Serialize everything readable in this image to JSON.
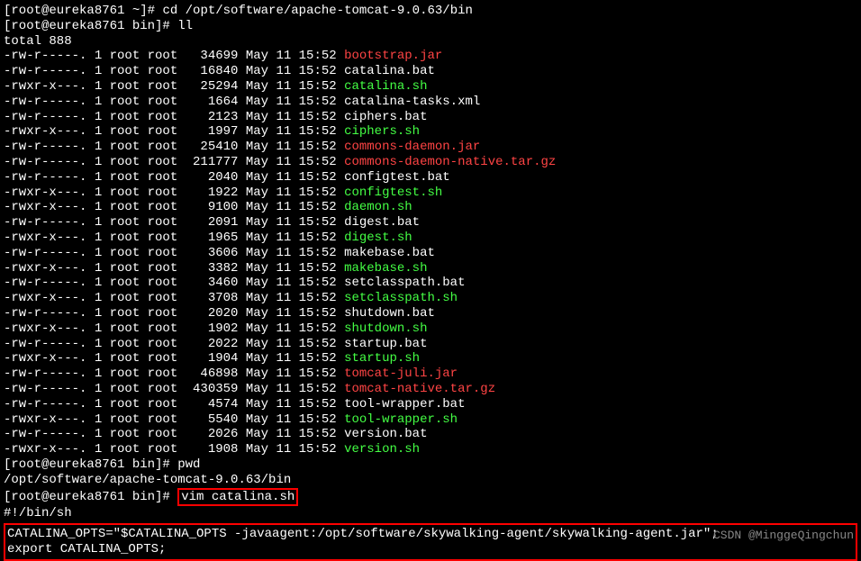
{
  "prompts": {
    "p1_host": "[root@eureka8761 ~]# ",
    "p1_cmd": "cd /opt/software/apache-tomcat-9.0.63/bin",
    "p2_host": "[root@eureka8761 bin]# ",
    "p2_cmd": "ll",
    "total": "total 888",
    "p3_host": "[root@eureka8761 bin]# ",
    "p3_cmd": "pwd",
    "pwd_output": "/opt/software/apache-tomcat-9.0.63/bin",
    "p4_host": "[root@eureka8761 bin]# ",
    "p4_cmd": "vim catalina.sh",
    "shebang": "#!/bin/sh",
    "empty": "",
    "catalina_opts": "CATALINA_OPTS=\"$CATALINA_OPTS -javaagent:/opt/software/skywalking-agent/skywalking-agent.jar\";",
    "export_line": "export CATALINA_OPTS;"
  },
  "files": [
    {
      "perms": "-rw-r-----. 1 root root   34699 May 11 15:52 ",
      "name": "bootstrap.jar",
      "color": "red"
    },
    {
      "perms": "-rw-r-----. 1 root root   16840 May 11 15:52 ",
      "name": "catalina.bat",
      "color": "white"
    },
    {
      "perms": "-rwxr-x---. 1 root root   25294 May 11 15:52 ",
      "name": "catalina.sh",
      "color": "green"
    },
    {
      "perms": "-rw-r-----. 1 root root    1664 May 11 15:52 ",
      "name": "catalina-tasks.xml",
      "color": "white"
    },
    {
      "perms": "-rw-r-----. 1 root root    2123 May 11 15:52 ",
      "name": "ciphers.bat",
      "color": "white"
    },
    {
      "perms": "-rwxr-x---. 1 root root    1997 May 11 15:52 ",
      "name": "ciphers.sh",
      "color": "green"
    },
    {
      "perms": "-rw-r-----. 1 root root   25410 May 11 15:52 ",
      "name": "commons-daemon.jar",
      "color": "red"
    },
    {
      "perms": "-rw-r-----. 1 root root  211777 May 11 15:52 ",
      "name": "commons-daemon-native.tar.gz",
      "color": "red"
    },
    {
      "perms": "-rw-r-----. 1 root root    2040 May 11 15:52 ",
      "name": "configtest.bat",
      "color": "white"
    },
    {
      "perms": "-rwxr-x---. 1 root root    1922 May 11 15:52 ",
      "name": "configtest.sh",
      "color": "green"
    },
    {
      "perms": "-rwxr-x---. 1 root root    9100 May 11 15:52 ",
      "name": "daemon.sh",
      "color": "green"
    },
    {
      "perms": "-rw-r-----. 1 root root    2091 May 11 15:52 ",
      "name": "digest.bat",
      "color": "white"
    },
    {
      "perms": "-rwxr-x---. 1 root root    1965 May 11 15:52 ",
      "name": "digest.sh",
      "color": "green"
    },
    {
      "perms": "-rw-r-----. 1 root root    3606 May 11 15:52 ",
      "name": "makebase.bat",
      "color": "white"
    },
    {
      "perms": "-rwxr-x---. 1 root root    3382 May 11 15:52 ",
      "name": "makebase.sh",
      "color": "green"
    },
    {
      "perms": "-rw-r-----. 1 root root    3460 May 11 15:52 ",
      "name": "setclasspath.bat",
      "color": "white"
    },
    {
      "perms": "-rwxr-x---. 1 root root    3708 May 11 15:52 ",
      "name": "setclasspath.sh",
      "color": "green"
    },
    {
      "perms": "-rw-r-----. 1 root root    2020 May 11 15:52 ",
      "name": "shutdown.bat",
      "color": "white"
    },
    {
      "perms": "-rwxr-x---. 1 root root    1902 May 11 15:52 ",
      "name": "shutdown.sh",
      "color": "green"
    },
    {
      "perms": "-rw-r-----. 1 root root    2022 May 11 15:52 ",
      "name": "startup.bat",
      "color": "white"
    },
    {
      "perms": "-rwxr-x---. 1 root root    1904 May 11 15:52 ",
      "name": "startup.sh",
      "color": "green"
    },
    {
      "perms": "-rw-r-----. 1 root root   46898 May 11 15:52 ",
      "name": "tomcat-juli.jar",
      "color": "red"
    },
    {
      "perms": "-rw-r-----. 1 root root  430359 May 11 15:52 ",
      "name": "tomcat-native.tar.gz",
      "color": "red"
    },
    {
      "perms": "-rw-r-----. 1 root root    4574 May 11 15:52 ",
      "name": "tool-wrapper.bat",
      "color": "white"
    },
    {
      "perms": "-rwxr-x---. 1 root root    5540 May 11 15:52 ",
      "name": "tool-wrapper.sh",
      "color": "green"
    },
    {
      "perms": "-rw-r-----. 1 root root    2026 May 11 15:52 ",
      "name": "version.bat",
      "color": "white"
    },
    {
      "perms": "-rwxr-x---. 1 root root    1908 May 11 15:52 ",
      "name": "version.sh",
      "color": "green"
    }
  ],
  "watermark": "CSDN @MinggeQingchun"
}
